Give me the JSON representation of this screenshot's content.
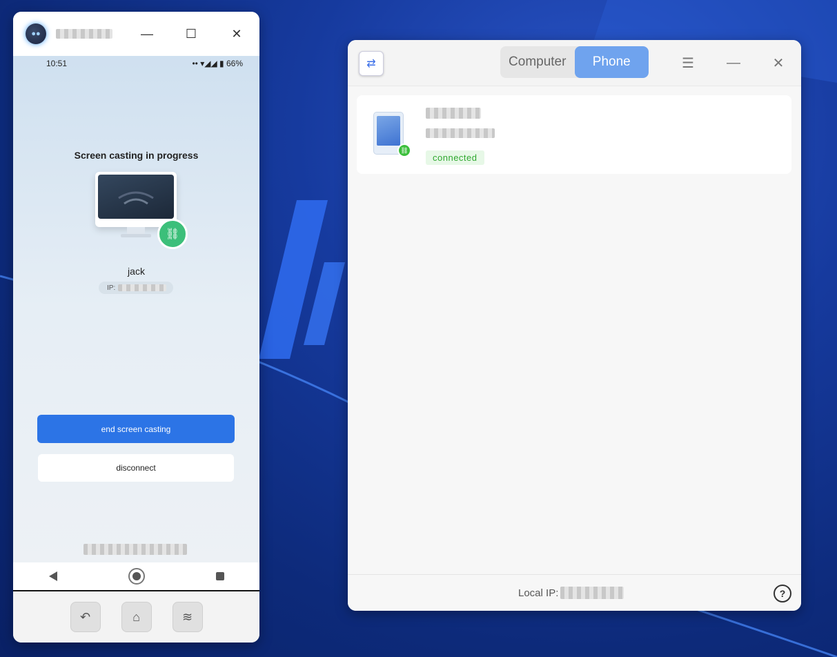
{
  "phone_window": {
    "title_bar": {
      "minimize_icon": "—",
      "maximize_icon": "☐",
      "close_icon": "✕"
    },
    "status_bar": {
      "time": "10:51",
      "indicators": "•• ▾◢◢ ▮",
      "battery": "66%"
    },
    "casting_title": "Screen casting in progress",
    "device_name": "jack",
    "ip_label": "IP:",
    "end_button": "end screen casting",
    "disconnect_button": "disconnect",
    "nav": {
      "back_icon": "back-icon",
      "home_icon": "home-icon",
      "recent_icon": "recent-apps-icon"
    },
    "toolbar": {
      "back_icon": "↶",
      "home_icon": "⌂",
      "layers_icon": "≋"
    }
  },
  "desktop_window": {
    "logo_icon": "⇄",
    "tabs": [
      {
        "label": "Computer",
        "active": false
      },
      {
        "label": "Phone",
        "active": true
      }
    ],
    "menu_icon": "☰",
    "minimize_icon": "—",
    "close_icon": "✕",
    "device_card": {
      "status": "connected"
    },
    "footer": {
      "local_ip_label": "Local IP:",
      "help_icon": "?"
    }
  },
  "colors": {
    "accent": "#2c74e6",
    "tab_active": "#6fa3ee",
    "connected_green": "#2fa82f",
    "link_badge": "#3cbf7a"
  }
}
